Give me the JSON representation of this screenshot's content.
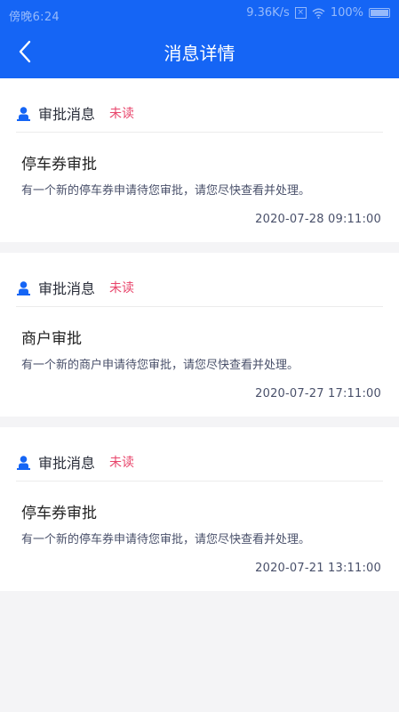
{
  "status_bar": {
    "time": "傍晚6:24",
    "network_speed": "9.36K/s",
    "battery": "100%"
  },
  "header": {
    "title": "消息详情"
  },
  "messages": [
    {
      "type_label": "审批消息",
      "status": "未读",
      "title": "停车券审批",
      "description": "有一个新的停车券申请待您审批，请您尽快查看并处理。",
      "time": "2020-07-28 09:11:00"
    },
    {
      "type_label": "审批消息",
      "status": "未读",
      "title": "商户审批",
      "description": "有一个新的商户申请待您审批，请您尽快查看并处理。",
      "time": "2020-07-27 17:11:00"
    },
    {
      "type_label": "审批消息",
      "status": "未读",
      "title": "停车券审批",
      "description": "有一个新的停车券申请待您审批，请您尽快查看并处理。",
      "time": "2020-07-21 13:11:00"
    }
  ],
  "icons": {
    "back": "back-arrow-icon",
    "message_type": "person-icon",
    "wifi": "wifi-icon",
    "battery": "battery-icon"
  },
  "colors": {
    "header_bg": "#1565f5",
    "unread": "#e8456b",
    "icon_blue": "#1565f5"
  }
}
